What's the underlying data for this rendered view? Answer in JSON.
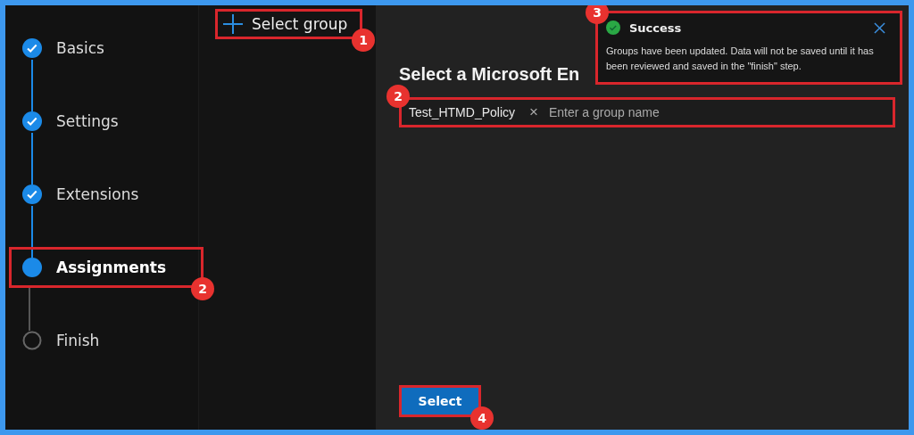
{
  "steps": [
    {
      "label": "Basics",
      "kind": "done",
      "selected": false
    },
    {
      "label": "Settings",
      "kind": "done",
      "selected": false
    },
    {
      "label": "Extensions",
      "kind": "done",
      "selected": false
    },
    {
      "label": "Assignments",
      "kind": "current",
      "selected": true,
      "callout": "2"
    },
    {
      "label": "Finish",
      "kind": "pending",
      "selected": false
    }
  ],
  "select_group": {
    "label": "Select group",
    "callout": "1"
  },
  "panel": {
    "title": "Select a Microsoft En"
  },
  "group_field": {
    "chip": "Test_HTMD_Policy",
    "chip_remove": "×",
    "placeholder": "Enter a group name",
    "callout": "2"
  },
  "select_button": {
    "label": "Select",
    "callout": "4"
  },
  "toast": {
    "title": "Success",
    "message": "Groups have been updated. Data will not be saved until it has been reviewed and saved in the \"finish\" step.",
    "callout": "3"
  }
}
